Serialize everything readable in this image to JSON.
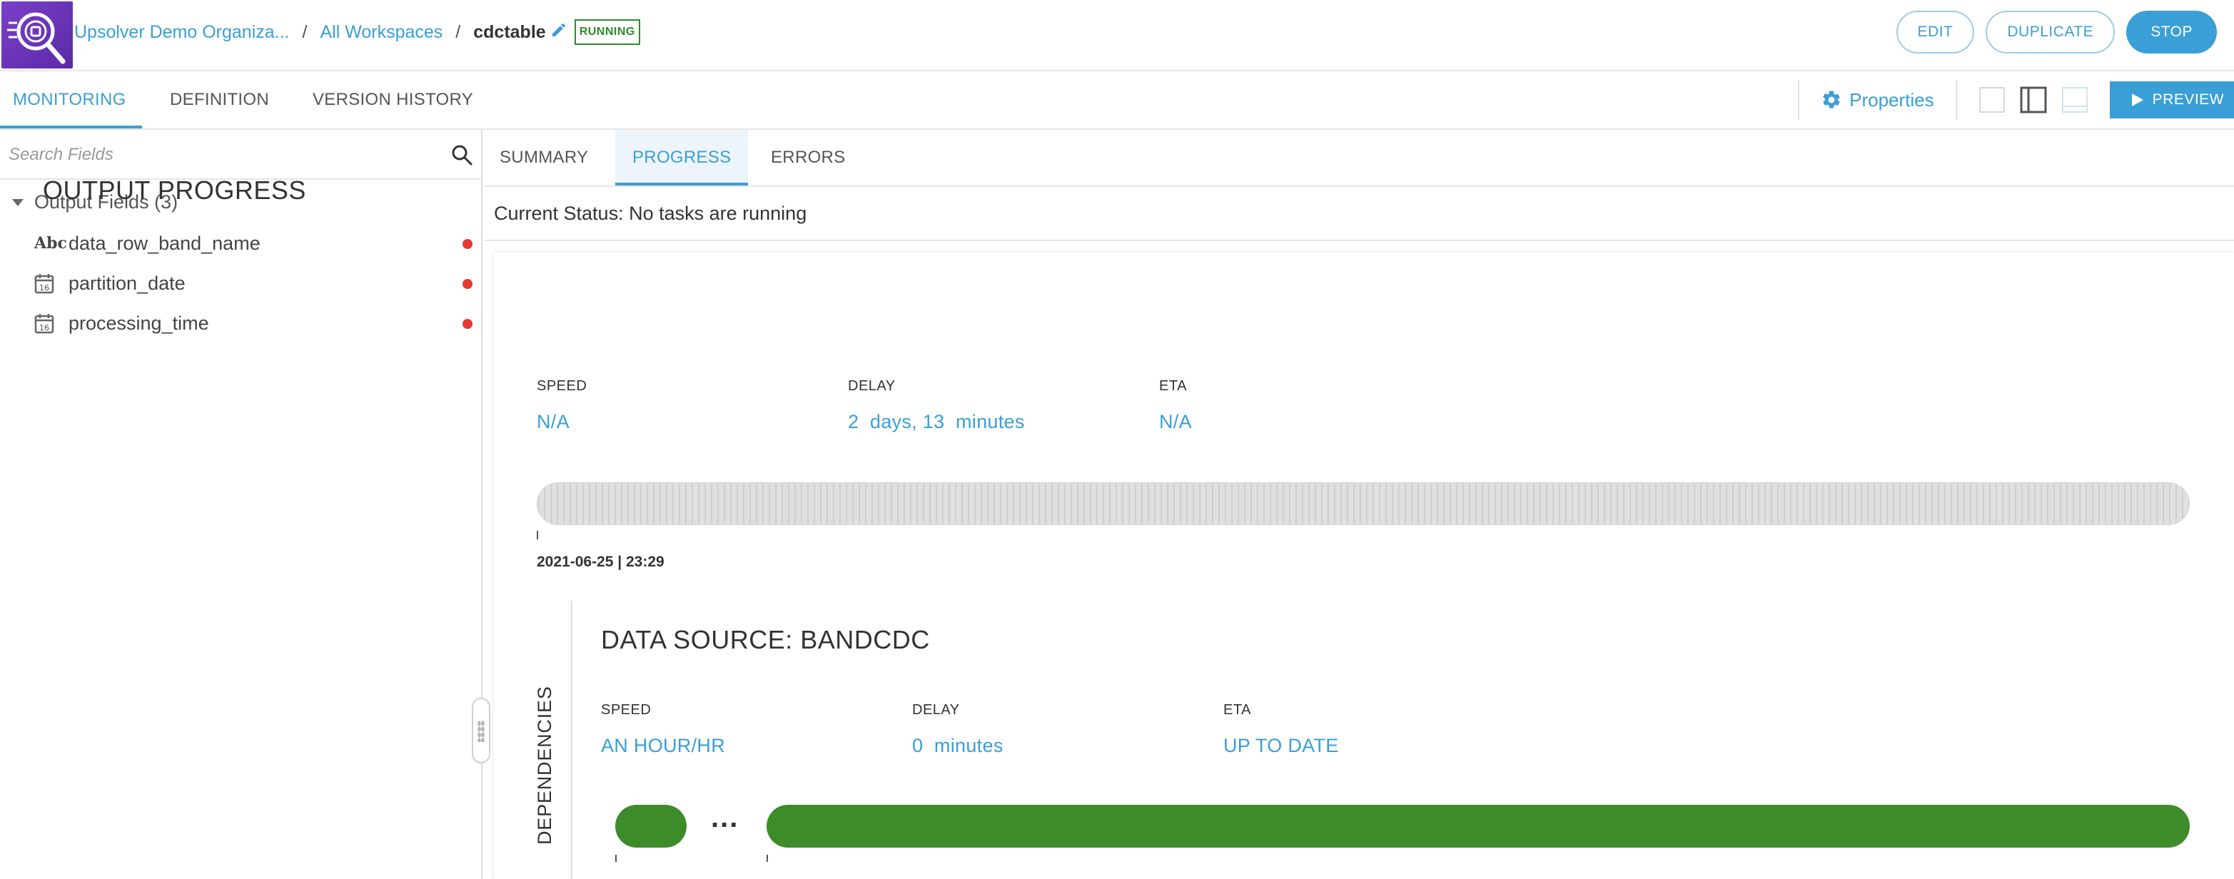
{
  "breadcrumb": {
    "organization": "Upsolver Demo Organiza...",
    "workspaces": "All Workspaces",
    "separator": "/",
    "current": "cdctable",
    "status": "RUNNING"
  },
  "actions": {
    "edit": "EDIT",
    "duplicate": "DUPLICATE",
    "stop": "STOP"
  },
  "main_tabs": [
    {
      "label": "MONITORING",
      "active": true
    },
    {
      "label": "DEFINITION",
      "active": false
    },
    {
      "label": "VERSION HISTORY",
      "active": false
    }
  ],
  "toolbar": {
    "properties": "Properties",
    "preview": "PREVIEW"
  },
  "search": {
    "placeholder": "Search Fields"
  },
  "tree": {
    "group_label": "Output Fields (3)",
    "fields": [
      {
        "name": "data_row_band_name",
        "type_icon": "abc-type-icon",
        "has_error": true
      },
      {
        "name": "partition_date",
        "type_icon": "calendar-icon",
        "has_error": true
      },
      {
        "name": "processing_time",
        "type_icon": "calendar-icon",
        "has_error": true
      }
    ],
    "abc_text": "Abc",
    "calendar_text": "16"
  },
  "content_tabs": [
    {
      "label": "SUMMARY",
      "active": false
    },
    {
      "label": "PROGRESS",
      "active": true
    },
    {
      "label": "ERRORS",
      "active": false
    }
  ],
  "current_status": "Current Status: No tasks are running",
  "output_progress": {
    "title": "OUTPUT PROGRESS",
    "speed_label": "SPEED",
    "speed_value": "N/A",
    "delay_label": "DELAY",
    "delay_value": "2  days, 13  minutes",
    "eta_label": "ETA",
    "eta_value": "N/A",
    "timestamp": "2021-06-25 | 23:29"
  },
  "dependencies": {
    "label": "DEPENDENCIES",
    "source_title": "DATA SOURCE: BANDCDC",
    "speed_label": "SPEED",
    "speed_value": "AN HOUR/HR",
    "delay_label": "DELAY",
    "delay_value": "0  minutes",
    "eta_label": "ETA",
    "eta_value": "UP TO DATE",
    "gap_indicator": "..."
  },
  "colors": {
    "accent": "#3a9fd6",
    "running": "#2e8b2e",
    "progress_green": "#3d8b29",
    "error_dot": "#e53935",
    "logo_purple": "#6a32b8"
  }
}
